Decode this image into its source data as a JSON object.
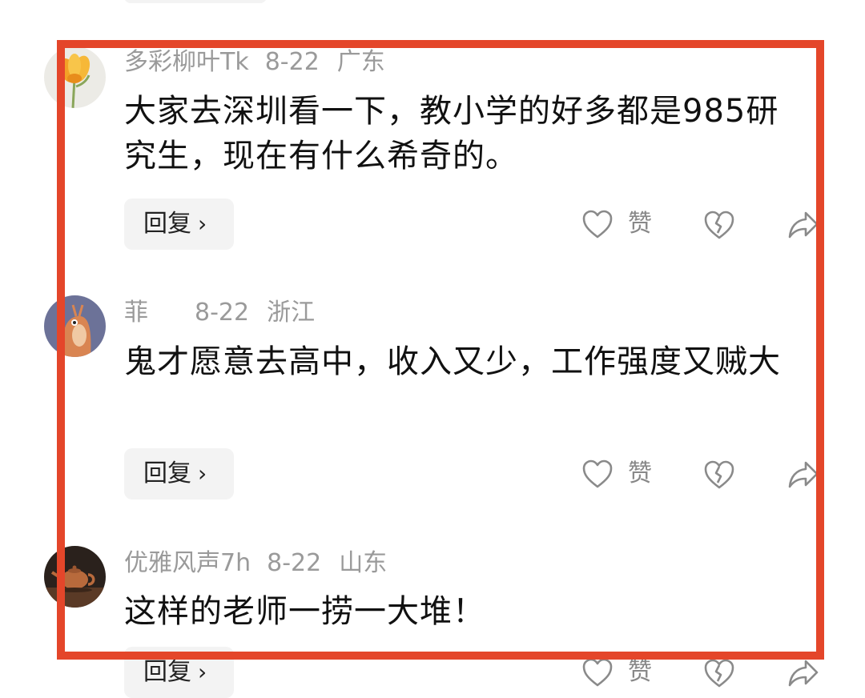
{
  "comments": [
    {
      "username": "多彩柳叶Tk",
      "date": "8-22",
      "location": "广东",
      "text": "大家去深圳看一下，教小学的好多都是985研究生，现在有什么希奇的。",
      "reply_label": "回复",
      "like_label": "赞",
      "avatar_icon": "yellow-flower-icon"
    },
    {
      "username": "菲",
      "date": "8-22",
      "location": "浙江",
      "text": "鬼才愿意去高中，收入又少，工作强度又贼大",
      "reply_label": "回复",
      "like_label": "赞",
      "avatar_icon": "cartoon-creature-icon"
    },
    {
      "username": "优雅风声7h",
      "date": "8-22",
      "location": "山东",
      "text": "这样的老师一捞一大堆！",
      "reply_label": "回复",
      "like_label": "赞",
      "avatar_icon": "teapot-icon"
    }
  ],
  "colors": {
    "highlight_border": "#e4462a",
    "meta_gray": "#9a9a9a",
    "button_bg": "#f3f3f3"
  }
}
